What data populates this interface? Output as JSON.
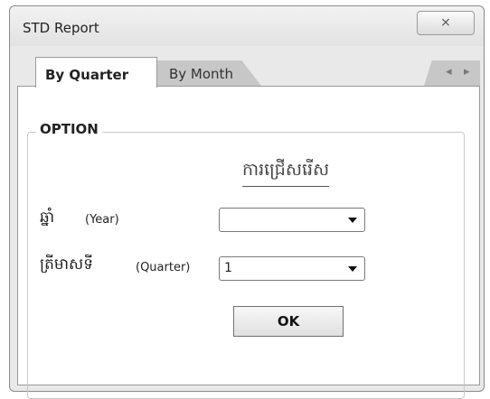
{
  "window": {
    "title": "STD Report",
    "close_glyph": "⨯"
  },
  "tabs": [
    {
      "label": "By Quarter",
      "active": true
    },
    {
      "label": "By Month",
      "active": false
    }
  ],
  "tab_nav": {
    "left": "◂",
    "right": "▸"
  },
  "option_group": {
    "legend": "OPTION",
    "heading": "ការជ្រើសរើស",
    "year": {
      "label": "ឆ្នាំ",
      "sublabel": "(Year)",
      "value": ""
    },
    "quarter": {
      "label": "ត្រីមាសទី",
      "sublabel": "(Quarter)",
      "value": "1"
    },
    "ok_label": "OK"
  },
  "colors": {
    "background": "#e9e9e9",
    "tab_inactive": "#c7c7c7"
  }
}
